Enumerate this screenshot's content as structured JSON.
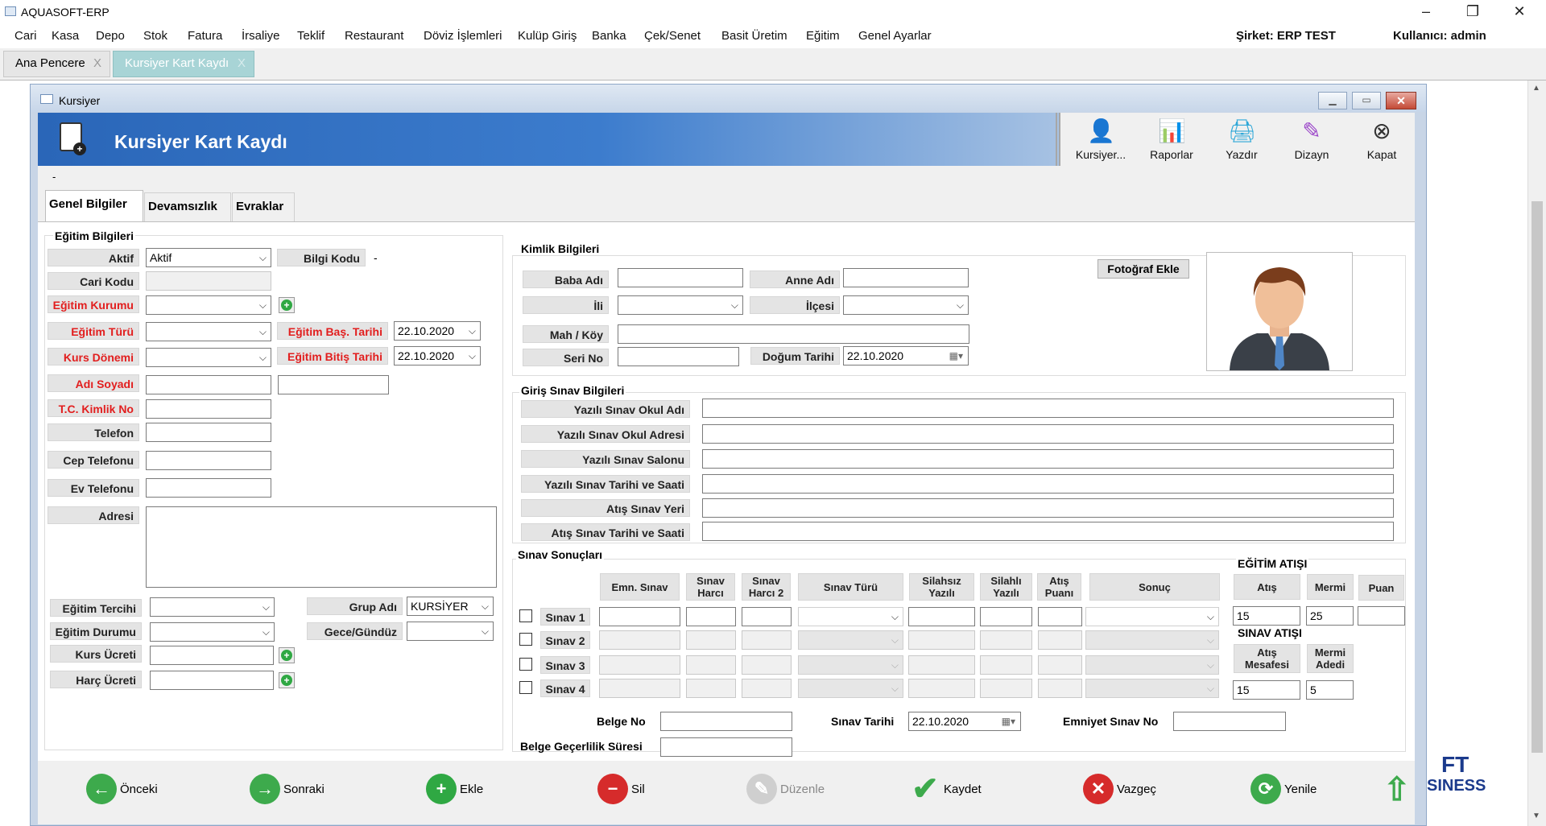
{
  "app": {
    "title": "AQUASOFT-ERP"
  },
  "menu": {
    "items": [
      "Cari",
      "Kasa",
      "Depo",
      "Stok",
      "Fatura",
      "İrsaliye",
      "Teklif",
      "Restaurant",
      "Döviz İşlemleri",
      "Kulüp Giriş",
      "Banka",
      "Çek/Senet",
      "Basit Üretim",
      "Eğitim",
      "Genel Ayarlar"
    ],
    "company": "Şirket: ERP TEST",
    "user": "Kullanıcı: admin"
  },
  "doc_tabs": [
    {
      "label": "Ana Pencere",
      "close": "X"
    },
    {
      "label": "Kursiyer Kart Kaydı",
      "close": "X"
    }
  ],
  "child": {
    "title": "Kursiyer"
  },
  "banner": {
    "title": "Kursiyer Kart Kaydı"
  },
  "toolbar": [
    "Kursiyer...",
    "Raporlar",
    "Yazdır",
    "Dizayn",
    "Kapat"
  ],
  "dash": "-",
  "tabs": [
    "Genel Bilgiler",
    "Devamsızlık",
    "Evraklar"
  ],
  "egitim": {
    "group": "Eğitim Bilgileri",
    "aktif_label": "Aktif",
    "aktif_value": "Aktif",
    "bilgi_kodu_label": "Bilgi Kodu",
    "bilgi_kodu_value": "-",
    "cari_kodu_label": "Cari Kodu",
    "kurum_label": "Eğitim Kurumu",
    "tur_label": "Eğitim Türü",
    "bas_tarih_label": "Eğitim Baş. Tarihi",
    "bas_tarih_value": "22.10.2020",
    "donem_label": "Kurs Dönemi",
    "bitis_label": "Eğitim Bitiş Tarihi",
    "bitis_value": "22.10.2020",
    "adsoyad_label": "Adı Soyadı",
    "tc_label": "T.C. Kimlik No",
    "tel_label": "Telefon",
    "cep_label": "Cep Telefonu",
    "ev_label": "Ev Telefonu",
    "adres_label": "Adresi",
    "tercih_label": "Eğitim Tercihi",
    "grup_label": "Grup Adı",
    "grup_value": "KURSİYER",
    "durum_label": "Eğitim Durumu",
    "gece_label": "Gece/Gündüz",
    "kurs_ucret_label": "Kurs Ücreti",
    "harc_ucret_label": "Harç Ücreti"
  },
  "kimlik": {
    "group": "Kimlik Bilgileri",
    "baba": "Baba Adı",
    "anne": "Anne Adı",
    "il": "İli",
    "ilce": "İlçesi",
    "mah": "Mah / Köy",
    "seri": "Seri No",
    "dogum": "Doğum Tarihi",
    "dogum_value": "22.10.2020",
    "foto_button": "Fotoğraf Ekle"
  },
  "giris": {
    "group": "Giriş Sınav Bilgileri",
    "rows": [
      "Yazılı Sınav Okul Adı",
      "Yazılı Sınav Okul Adresi",
      "Yazılı Sınav Salonu",
      "Yazılı Sınav Tarihi ve Saati",
      "Atış Sınav Yeri",
      "Atış Sınav Tarihi ve Saati"
    ]
  },
  "sinav": {
    "group": "Sınav Sonuçları",
    "headers": [
      "Emn. Sınav",
      "Sınav Harcı",
      "Sınav Harcı 2",
      "Sınav Türü",
      "Silahsız Yazılı",
      "Silahlı Yazılı",
      "Atış Puanı",
      "Sonuç"
    ],
    "rows": [
      "Sınav 1",
      "Sınav 2",
      "Sınav 3",
      "Sınav 4"
    ],
    "belge_no": "Belge No",
    "sinav_tarihi": "Sınav Tarihi",
    "sinav_tarihi_value": "22.10.2020",
    "emniyet": "Emniyet Sınav No",
    "belge_sure": "Belge Geçerlilik Süresi"
  },
  "egitim_atisi": {
    "group": "EĞİTİM ATIŞI",
    "headers": [
      "Atış",
      "Mermi",
      "Puan"
    ],
    "values": [
      "15",
      "25",
      ""
    ]
  },
  "sinav_atisi": {
    "group": "SINAV ATIŞI",
    "headers": [
      "Atış Mesafesi",
      "Mermi Adedi"
    ],
    "values": [
      "15",
      "5"
    ]
  },
  "bottom": [
    "Önceki",
    "Sonraki",
    "Ekle",
    "Sil",
    "Düzenle",
    "Kaydet",
    "Vazgeç",
    "Yenile"
  ],
  "bg_logo": [
    "FT",
    "SINESS"
  ],
  "colors": {
    "banner": "#2a66b8",
    "required_label": "#e21e1e",
    "active_tab": "#a8d4d6"
  }
}
